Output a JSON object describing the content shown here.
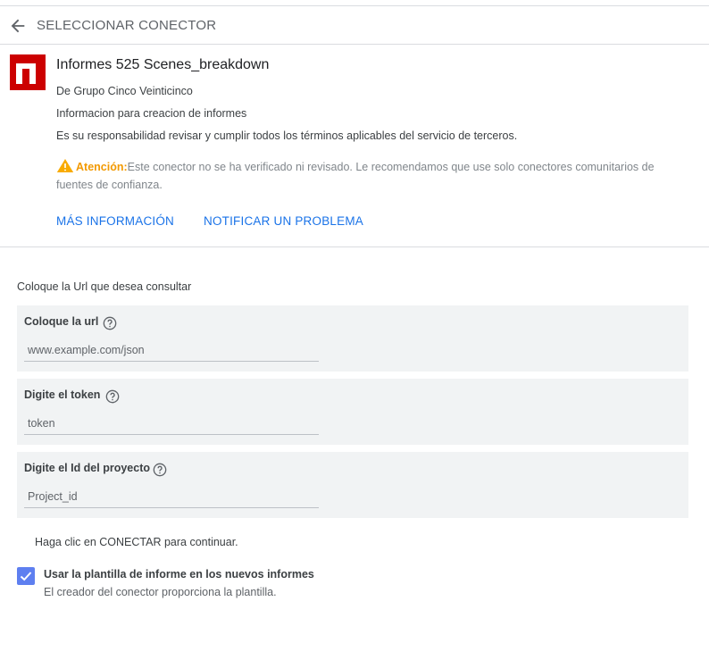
{
  "header": {
    "title": "SELECCIONAR CONECTOR"
  },
  "connector": {
    "name": "Informes 525 Scenes_breakdown",
    "author": "De Grupo Cinco Veinticinco",
    "description": "Informacion para creacion de informes",
    "terms": "Es su responsabilidad revisar y cumplir todos los términos aplicables del servicio de terceros.",
    "warning_label": "Atención:",
    "warning_text": "Este conector no se ha verificado ni revisado. Le recomendamos que use solo conectores comunitarios de fuentes de confianza.",
    "links": {
      "more_info": "MÁS INFORMACIÓN",
      "report_problem": "NOTIFICAR UN PROBLEMA"
    }
  },
  "config": {
    "section_label": "Coloque la Url que desea consultar",
    "fields": [
      {
        "label": "Coloque la url",
        "placeholder": "www.example.com/json"
      },
      {
        "label": "Digite el token",
        "placeholder": "token"
      },
      {
        "label": "Digite el Id del proyecto",
        "placeholder": "Project_id"
      }
    ],
    "hint": "Haga clic en CONECTAR para continuar.",
    "template_checkbox": {
      "checked": true,
      "label": "Usar la plantilla de informe en los nuevos informes",
      "sublabel": "El creador del conector proporciona la plantilla."
    }
  },
  "colors": {
    "link": "#1a73e8",
    "warning": "#f29900",
    "logo": "#cc0000",
    "checkbox": "#5e7ff0"
  }
}
